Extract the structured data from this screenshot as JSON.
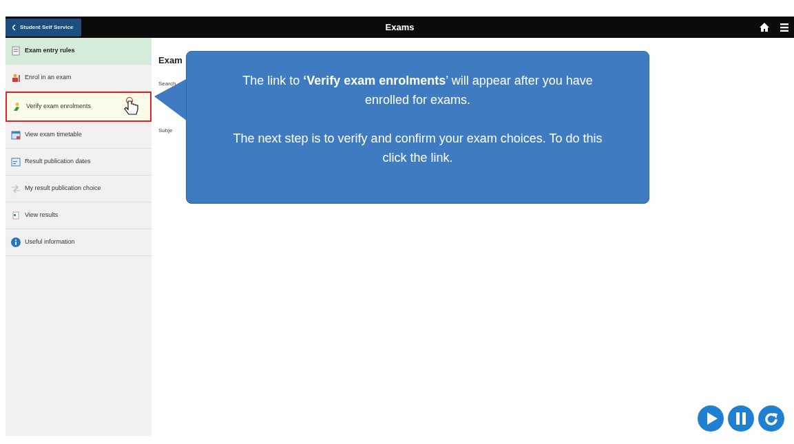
{
  "navbar": {
    "back_button": "Student Self Service",
    "title": "Exams"
  },
  "sidebar": {
    "items": [
      {
        "label": "Exam entry rules",
        "selected": true,
        "highlighted": false
      },
      {
        "label": "Enrol in an exam",
        "selected": false,
        "highlighted": false
      },
      {
        "label": "Verify exam enrolments",
        "selected": false,
        "highlighted": true
      },
      {
        "label": "View exam timetable",
        "selected": false,
        "highlighted": false
      },
      {
        "label": "Result publication dates",
        "selected": false,
        "highlighted": false
      },
      {
        "label": "My result publication choice",
        "selected": false,
        "highlighted": false
      },
      {
        "label": "View results",
        "selected": false,
        "highlighted": false
      },
      {
        "label": "Useful information",
        "selected": false,
        "highlighted": false
      }
    ]
  },
  "content": {
    "heading": "Exam",
    "search_label": "Search",
    "subject_label": "Subje"
  },
  "callout": {
    "paragraphs": [
      "The link to  **‘Verify exam enrolments**’ will appear after you have enrolled for exams.",
      "The next step is to verify and confirm your exam choices. To do this click the link."
    ]
  }
}
